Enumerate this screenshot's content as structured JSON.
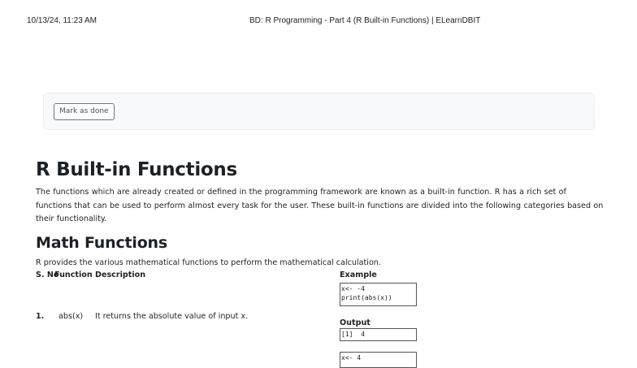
{
  "print_header": {
    "datetime": "10/13/24, 11:23 AM",
    "page_title": "BD: R Programming - Part 4 (R Built-in Functions) | ELearnDBIT"
  },
  "activity": {
    "mark_done_label": "Mark as done"
  },
  "content": {
    "heading": "R Built-in Functions",
    "intro": "The functions which are already created or defined in the programming framework are known as a built-in function. R has a rich set of functions that can be used to perform almost every task for the user. These built-in functions are divided into the following categories based on their functionality.",
    "math_heading": "Math Functions",
    "math_description": "R provides the various mathematical functions to perform the mathematical calculation."
  },
  "table": {
    "headers": {
      "sno": "S. No",
      "function": "Function",
      "description": "Description",
      "example": "Example",
      "output": "Output"
    },
    "rows": [
      {
        "sno": "1.",
        "function": "abs(x)",
        "description": "It returns the absolute value of input x.",
        "example": "x<- -4\nprint(abs(x))",
        "output": "[1]  4"
      }
    ],
    "next_example_preview": "x<- 4"
  }
}
